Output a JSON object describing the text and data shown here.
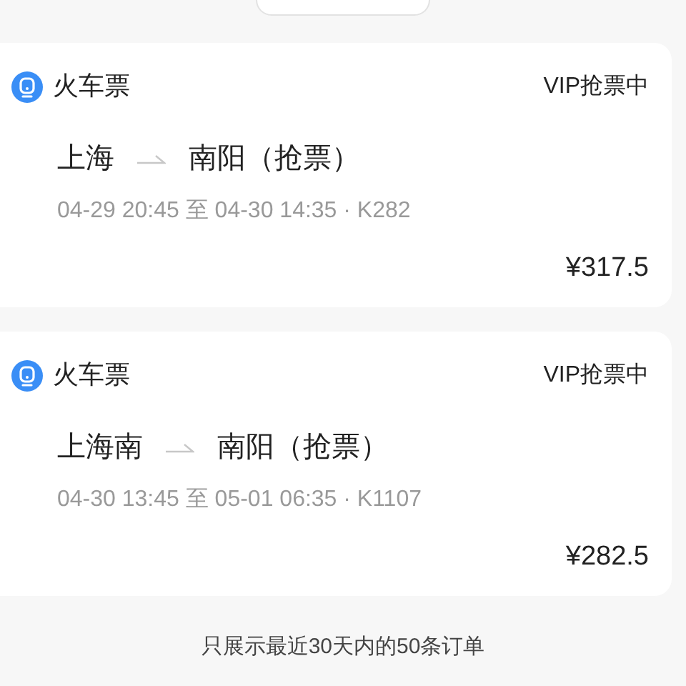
{
  "orders": [
    {
      "category": "火车票",
      "status": "VIP抢票中",
      "from": "上海",
      "to": "南阳（抢票）",
      "schedule": "04-29 20:45 至 04-30 14:35 · K282",
      "price": "¥317.5"
    },
    {
      "category": "火车票",
      "status": "VIP抢票中",
      "from": "上海南",
      "to": "南阳（抢票）",
      "schedule": "04-30 13:45 至 05-01 06:35 · K1107",
      "price": "¥282.5"
    }
  ],
  "footer_note": "只展示最近30天内的50条订单"
}
